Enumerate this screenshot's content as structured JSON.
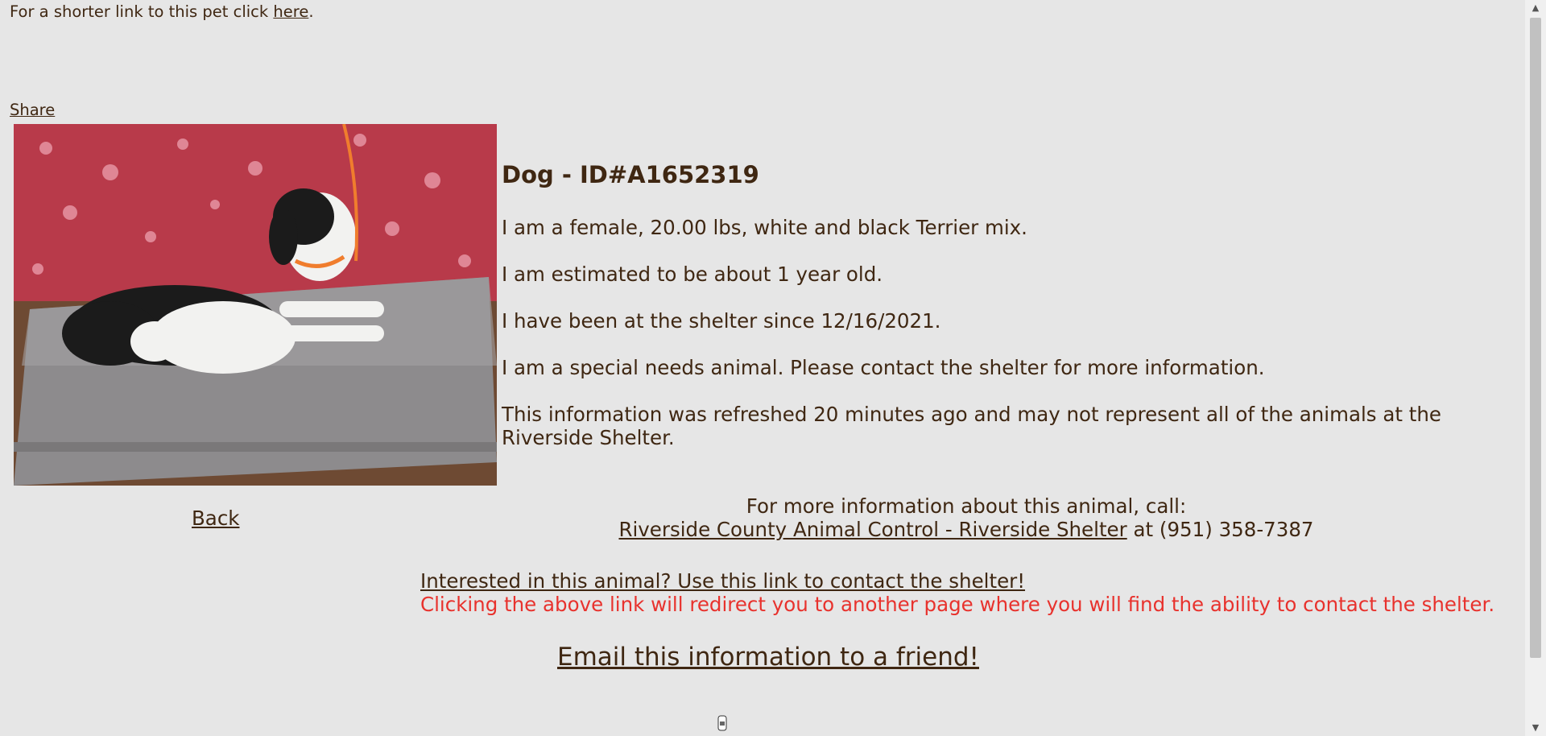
{
  "topline": {
    "prefix": "For a shorter link to this pet click ",
    "link": "here",
    "suffix": "."
  },
  "share_label": "Share",
  "pet": {
    "title": "Dog - ID#A1652319",
    "lines": [
      "I am a female, 20.00 lbs, white and black Terrier mix.",
      "I am estimated to be about 1 year old.",
      "I have been at the shelter since 12/16/2021.",
      "I am a special needs animal. Please contact the shelter for more information.",
      "This information was refreshed 20 minutes ago and may not represent all of the animals at the Riverside Shelter."
    ]
  },
  "back_label": "Back",
  "contact": {
    "intro": "For more information about this animal, call:",
    "shelter_link": "Riverside County Animal Control - Riverside Shelter",
    "at_text": " at (951) 358-7387"
  },
  "interest": {
    "link": "Interested in this animal? Use this link to contact the shelter!",
    "note": "Clicking the above link will redirect you to another page where you will find the ability to contact the shelter."
  },
  "email_label": "Email this information to a friend!",
  "colors": {
    "background": "#e6e6e6",
    "text": "#3f2712",
    "warning": "#e8322d"
  }
}
